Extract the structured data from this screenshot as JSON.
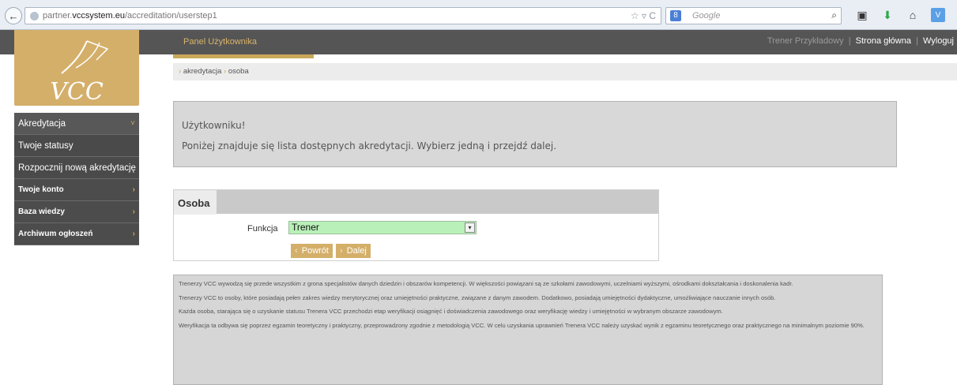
{
  "browser": {
    "url_host_prefix": "partner.",
    "url_host_main": "vccsystem.eu",
    "url_path": "/accreditation/userstep1",
    "search_engine_label": "8",
    "search_placeholder": "Google"
  },
  "header": {
    "panel_title": "Panel Użytkownika",
    "user_name": "Trener Przykładowy",
    "home_link": "Strona główna",
    "logout_link": "Wyloguj",
    "separator": "|"
  },
  "logo": {
    "text": "VCC"
  },
  "sidebar": {
    "items": [
      {
        "label": "Akredytacja",
        "arrow": "˅"
      },
      {
        "label": "Twoje statusy"
      },
      {
        "label": "Rozpocznij nową akredytację"
      },
      {
        "label": "Twoje konto",
        "arrow": "›"
      },
      {
        "label": "Baza wiedzy",
        "arrow": "›"
      },
      {
        "label": "Archiwum ogłoszeń",
        "arrow": "›"
      }
    ]
  },
  "breadcrumb": {
    "arrow": "›",
    "items": [
      "akredytacja",
      "osoba"
    ]
  },
  "info": {
    "greeting": "Użytkowniku!",
    "message": "Poniżej znajduje się lista dostępnych akredytacji. Wybierz jedną i przejdź dalej."
  },
  "form": {
    "tab_title": "Osoba",
    "field_label": "Funkcja",
    "select_value": "Trener",
    "back_label": "Powrót",
    "next_label": "Dalej",
    "back_arrow": "‹",
    "next_arrow": "›"
  },
  "description": {
    "paragraphs": [
      "Trenerzy VCC wywodzą się przede wszystkim z grona specjalistów danych dziedzin i obszarów kompetencji. W większości powiązani są ze szkołami zawodowymi, uczelniami wyższymi, ośrodkami dokształcania i doskonalenia kadr.",
      "Trenerzy VCC to osoby, które posiadają pełen zakres wiedzy merytorycznej oraz umiejętności praktyczne, związane z danym zawodem. Dodatkowo, posiadają umiejętności dydaktyczne, umożliwiające nauczanie innych osób.",
      "Każda osoba, starająca się o uzyskanie statusu Trenera VCC przechodzi etap weryfikacji osiągnięć i doświadczenia zawodowego oraz weryfikację wiedzy i umiejętności w wybranym obszarze zawodowym.",
      "Weryfikacja ta odbywa się poprzez egzamin teoretyczny i praktyczny, przeprowadzony zgodnie z metodologią VCC. W celu uzyskania uprawnień Trenera VCC należy uzyskać wynik z egzaminu teoretycznego oraz praktycznego na minimalnym poziomie 90%."
    ]
  },
  "colors": {
    "gold": "#d4af6a",
    "dark_header": "#555555",
    "select_bg": "#b9f0b9"
  },
  "icons": [
    "back-arrow-icon",
    "globe-icon",
    "star-icon",
    "reload-icon",
    "search-icon",
    "bookmarks-icon",
    "download-icon",
    "home-icon",
    "addon-icon"
  ]
}
